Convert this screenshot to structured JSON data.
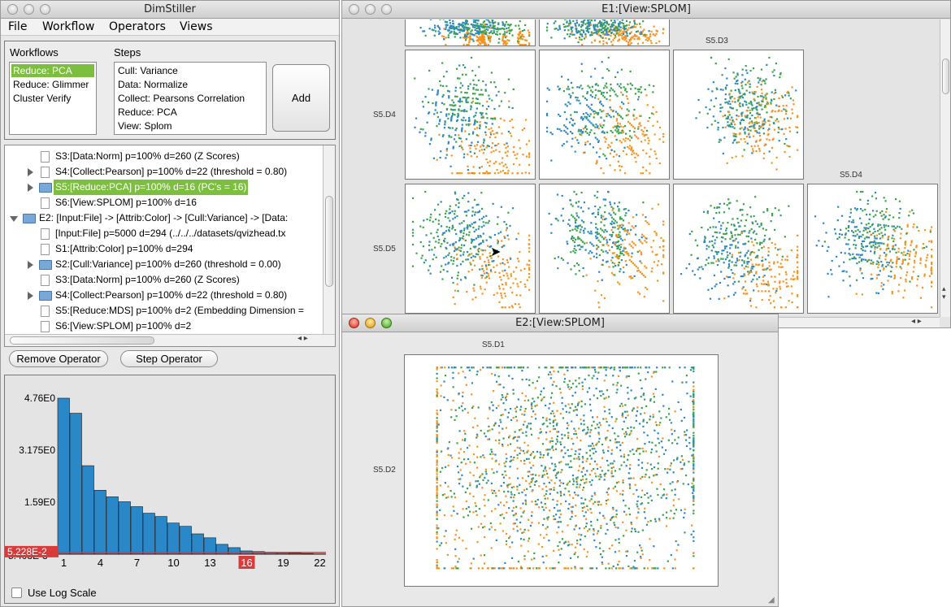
{
  "main_window": {
    "title": "DimStiller",
    "menu": [
      "File",
      "Workflow",
      "Operators",
      "Views"
    ],
    "workflows_label": "Workflows",
    "workflows": [
      "Reduce: PCA",
      "Reduce: Glimmer",
      "Cluster Verify"
    ],
    "steps_label": "Steps",
    "steps": [
      "Cull: Variance",
      "Data: Normalize",
      "Collect: Pearsons Correlation",
      "Reduce: PCA",
      "View: Splom"
    ],
    "add_button": "Add",
    "tree": [
      "S3:[Data:Norm] p=100% d=260 (Z Scores)",
      "S4:[Collect:Pearson] p=100% d=22 (threshold = 0.80)",
      "S5:[Reduce:PCA] p=100% d=16 (PC's = 16)",
      "S6:[View:SPLOM] p=100% d=16",
      "E2: [Input:File] -> [Attrib:Color] -> [Cull:Variance] -> [Data:",
      "[Input:File] p=5000 d=294 (../../../datasets/qvizhead.tx",
      "S1:[Attrib:Color] p=100% d=294",
      "S2:[Cull:Variance] p=100% d=260 (threshold = 0.00)",
      "S3:[Data:Norm] p=100% d=260 (Z Scores)",
      "S4:[Collect:Pearson] p=100% d=22 (threshold = 0.80)",
      "S5:[Reduce:MDS] p=100% d=2 (Embedding Dimension =",
      "S6:[View:SPLOM] p=100% d=2"
    ],
    "remove_button": "Remove Operator",
    "step_button": "Step Operator",
    "log_scale_label": "Use Log Scale"
  },
  "histogram": {
    "y_ticks": [
      "4.76E0",
      "3.175E0",
      "1.59E0",
      "5.403E-3"
    ],
    "threshold_label": "5.228E-2",
    "x_ticks": [
      "1",
      "4",
      "7",
      "10",
      "13",
      "16",
      "19",
      "22"
    ],
    "selected_x": "16",
    "accent": "#d93b3b",
    "bar_color": "#2b88c8"
  },
  "chart_data": {
    "type": "bar",
    "categories": [
      "1",
      "2",
      "3",
      "4",
      "5",
      "6",
      "7",
      "8",
      "9",
      "10",
      "11",
      "12",
      "13",
      "14",
      "15",
      "16",
      "17",
      "18",
      "19",
      "20",
      "21",
      "22"
    ],
    "values": [
      4.76,
      4.3,
      2.7,
      1.95,
      1.75,
      1.6,
      1.45,
      1.25,
      1.15,
      0.95,
      0.85,
      0.62,
      0.5,
      0.3,
      0.2,
      0.1,
      0.08,
      0.06,
      0.04,
      0.03,
      0.02,
      0.01
    ],
    "ylim": [
      0.005403,
      4.76
    ],
    "threshold": 0.05228,
    "selected_category": "16",
    "title": "",
    "xlabel": "",
    "ylabel": ""
  },
  "e1_window": {
    "title": "E1:[View:SPLOM]",
    "col_label_d3": "S5.D3",
    "col_label_d4": "S5.D4",
    "row_label_d4": "S5.D4",
    "row_label_d5": "S5.D5"
  },
  "e2_window": {
    "title": "E2:[View:SPLOM]",
    "col_label": "S5.D1",
    "row_label": "S5.D2"
  },
  "point_colors": {
    "blue": "#2b88c8",
    "green": "#3aa34a",
    "orange": "#f7931e"
  }
}
